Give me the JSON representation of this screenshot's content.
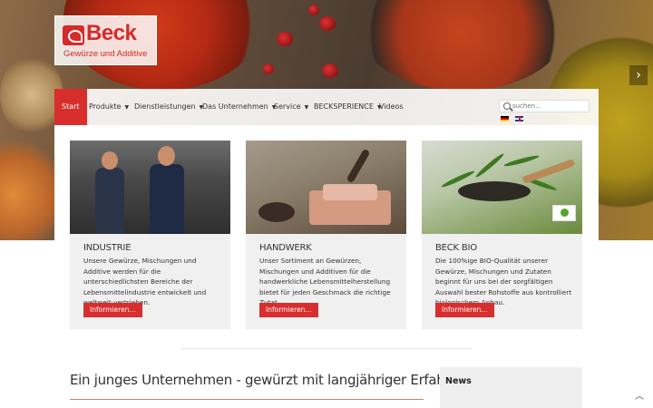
{
  "brand": {
    "name": "Beck",
    "tagline": "Gewürze und Additive",
    "color": "#d52b2b"
  },
  "nav": {
    "items": [
      {
        "label": "Start",
        "active": true
      },
      {
        "label": "Produkte",
        "dropdown": true
      },
      {
        "label": "Dienstleistungen",
        "dropdown": true
      },
      {
        "label": "Das Unternehmen",
        "dropdown": true
      },
      {
        "label": "Service",
        "dropdown": true
      },
      {
        "label": "BECKSPERIENCE",
        "dropdown": true
      },
      {
        "label": "Videos",
        "dropdown": false
      }
    ],
    "search_placeholder": "suchen...",
    "languages": [
      "de",
      "en"
    ]
  },
  "cards": [
    {
      "title": "INDUSTRIE",
      "text": "Unsere Gewürze, Mischungen und Additive werden für die unterschiedlichsten Bereiche der Lebensmittelindustrie entwickelt und weltweit vertrieben.",
      "button": "Informieren..."
    },
    {
      "title": "HANDWERK",
      "text": "Unser Sortiment an Gewürzen, Mischungen und Additiven für die handwerkliche Lebensmittelherstellung bietet für jeden Geschmack die richtige Zutat.",
      "button": "Informieren..."
    },
    {
      "title": "BECK BIO",
      "text": "Die 100%ige BIO-Qualität unserer Gewürze, Mischungen und Zutaten beginnt für uns bei der sorgfältigen Auswahl bester Rohstoffe aus kontrolliert biologischem Anbau.",
      "button": "Informieren..."
    }
  ],
  "main": {
    "headline": "Ein junges Unternehmen - gewürzt mit langjähriger Erfahrung"
  },
  "sidebar": {
    "news_title": "News"
  },
  "icons": {
    "slider_next": "chevron-right-icon",
    "back_to_top": "chevron-up-icon",
    "search": "search-icon"
  },
  "colors": {
    "accent": "#d92e2e",
    "card_bg": "#f0f0f0",
    "rule": "#c9836a"
  }
}
